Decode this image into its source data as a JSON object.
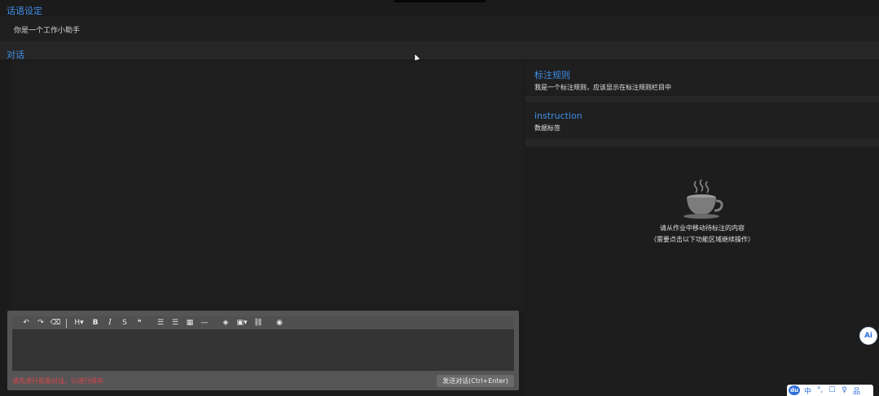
{
  "prompt_section": {
    "title": "话语设定",
    "prompt_text": "你是一个工作小助手"
  },
  "dialog_section": {
    "title": "对话"
  },
  "right_panel": {
    "rules_card": {
      "title": "标注规则",
      "body": "我是一个标注规则，应该显示在标注规则栏目中"
    },
    "instruction_card": {
      "title": "instruction",
      "body": "数据标签"
    },
    "empty_state": {
      "line1": "请从作业中移动待标注的内容",
      "line2": "（需要点击以下功能区域继续操作）"
    }
  },
  "editor": {
    "toolbar": {
      "undo": "↶",
      "redo": "↷",
      "clear_format": "⌫",
      "heading": "H▾",
      "bold": "B",
      "italic": "I",
      "strike": "S",
      "quote": "❝",
      "bullet_list": "☰",
      "ordered_list": "☰",
      "table": "▦",
      "hr": "—",
      "highlight": "◈",
      "image": "▣▾",
      "link": "⛓",
      "preview": "◉"
    },
    "warning": "请先进行前面对话，以进行保存",
    "send_label": "发送对话(Ctrl+Enter)"
  },
  "floating": {
    "ai_button": "Ai"
  },
  "ime_bar": {
    "logo": "du",
    "items": [
      "中",
      "°,",
      "☐",
      "♀",
      "品"
    ]
  },
  "colors": {
    "accent": "#3f8fe8",
    "warning": "#e0454b",
    "background": "#1b1b1c"
  }
}
